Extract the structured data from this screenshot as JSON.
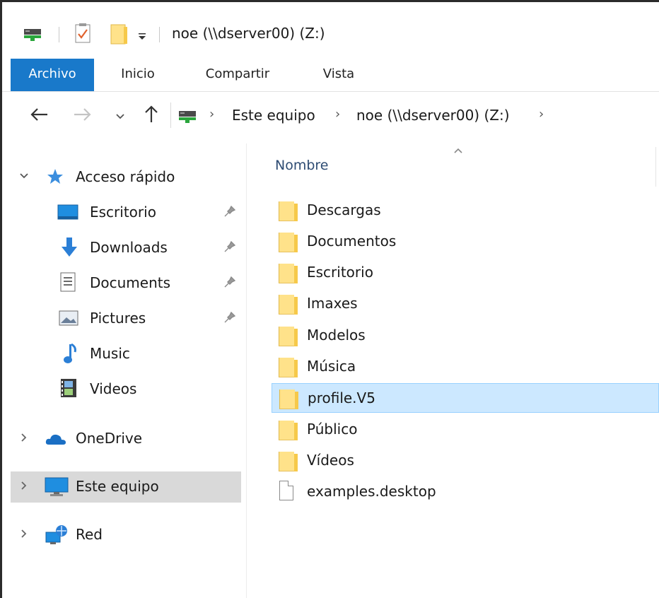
{
  "window": {
    "title": "noe (\\\\dserver00) (Z:)"
  },
  "ribbon": {
    "tabs": [
      {
        "label": "Archivo",
        "active": true
      },
      {
        "label": "Inicio",
        "active": false
      },
      {
        "label": "Compartir",
        "active": false
      },
      {
        "label": "Vista",
        "active": false
      }
    ]
  },
  "address": {
    "back_icon": "arrow-left",
    "forward_icon": "arrow-right",
    "recent_icon": "chevron-down",
    "up_icon": "arrow-up",
    "location_icon": "network-drive",
    "breadcrumbs": [
      "Este equipo",
      "noe (\\\\dserver00) (Z:)"
    ]
  },
  "navpane": {
    "quick_access": {
      "label": "Acceso rápido",
      "expanded": true,
      "items": [
        {
          "label": "Escritorio",
          "icon": "desktop",
          "pinned": true
        },
        {
          "label": "Downloads",
          "icon": "download-arrow",
          "pinned": true
        },
        {
          "label": "Documents",
          "icon": "document",
          "pinned": true
        },
        {
          "label": "Pictures",
          "icon": "picture",
          "pinned": true
        },
        {
          "label": "Music",
          "icon": "music-note",
          "pinned": false
        },
        {
          "label": "Videos",
          "icon": "film",
          "pinned": false
        }
      ]
    },
    "onedrive": {
      "label": "OneDrive",
      "icon": "cloud"
    },
    "this_pc": {
      "label": "Este equipo",
      "icon": "monitor",
      "selected": true
    },
    "network": {
      "label": "Red",
      "icon": "network"
    }
  },
  "content": {
    "column_header": "Nombre",
    "sort": "ascending",
    "items": [
      {
        "name": "Descargas",
        "type": "folder",
        "selected": false
      },
      {
        "name": "Documentos",
        "type": "folder",
        "selected": false
      },
      {
        "name": "Escritorio",
        "type": "folder",
        "selected": false
      },
      {
        "name": "Imaxes",
        "type": "folder",
        "selected": false
      },
      {
        "name": "Modelos",
        "type": "folder",
        "selected": false
      },
      {
        "name": "Música",
        "type": "folder",
        "selected": false
      },
      {
        "name": "profile.V5",
        "type": "folder",
        "selected": true
      },
      {
        "name": "Público",
        "type": "folder",
        "selected": false
      },
      {
        "name": "Vídeos",
        "type": "folder",
        "selected": false
      },
      {
        "name": "examples.desktop",
        "type": "file",
        "selected": false
      }
    ]
  }
}
